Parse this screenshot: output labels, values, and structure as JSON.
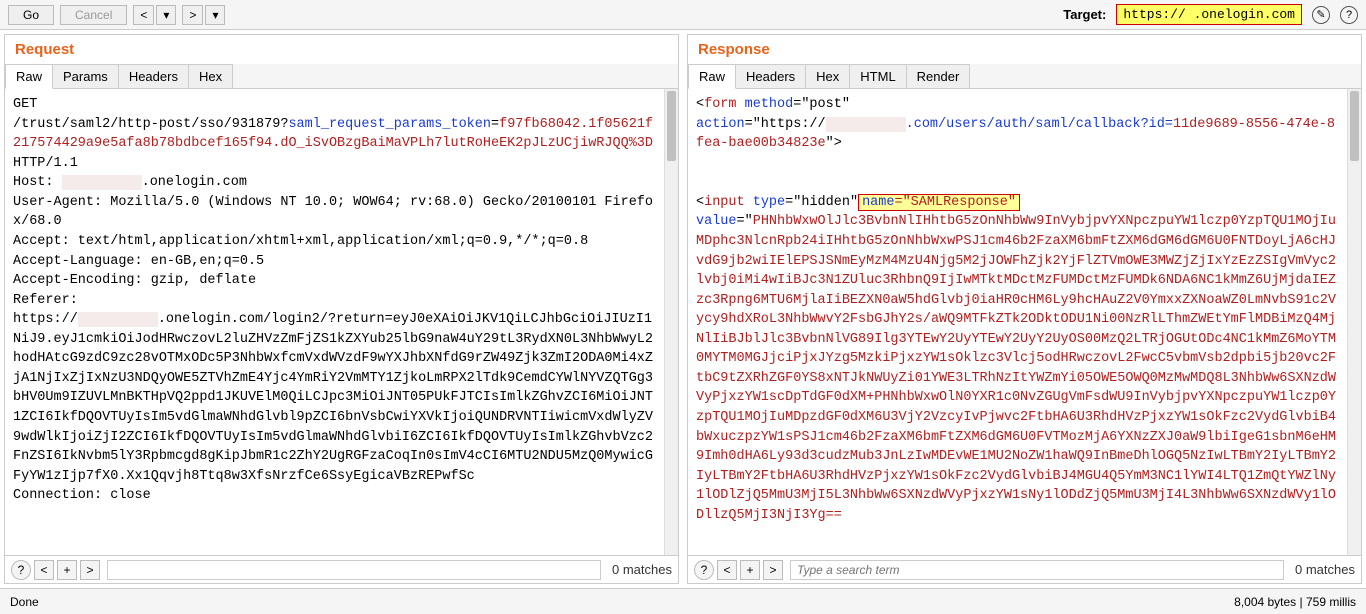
{
  "toolbar": {
    "go": "Go",
    "cancel": "Cancel",
    "prev_split": "<",
    "prev_down": "▾",
    "next_split": ">",
    "next_down": "▾",
    "target_label": "Target:",
    "target_value": "https://                  .onelogin.com"
  },
  "request": {
    "title": "Request",
    "tabs": [
      "Raw",
      "Params",
      "Headers",
      "Hex"
    ],
    "active_tab": 0,
    "method": "GET",
    "path1": "/trust/saml2/http-post/sso/931879?",
    "param_key": "saml_request_params_token",
    "param_val": "f97fb68042.1f05621f217574429a9e5afa8b78bdbcef165f94.dO_iSvOBzgBaiMaVPLh7lutRoHeEK2pJLzUCjiwRJQQ%3D",
    "httpver": " HTTP/1.1",
    "host_key": "Host: ",
    "host_val": ".onelogin.com",
    "ua": "User-Agent: Mozilla/5.0 (Windows NT 10.0; WOW64; rv:68.0) Gecko/20100101 Firefox/68.0",
    "accept": "Accept: text/html,application/xhtml+xml,application/xml;q=0.9,*/*;q=0.8",
    "acclang": "Accept-Language: en-GB,en;q=0.5",
    "accenc": "Accept-Encoding: gzip, deflate",
    "referer_key": "Referer:",
    "referer_scheme": "https://",
    "referer_rest": ".onelogin.com/login2/?return=eyJ0eXAiOiJKV1QiLCJhbGciOiJIUzI1NiJ9.eyJ1cmkiOiJodHRwczovL2luZHVzZmFjZS1kZXYub25lbG9naW4uY29tL3RydXN0L3NhbWwyL2hodHAtcG9zdC9zc28vOTMxODc5P3NhbWxfcmVxdWVzdF9wYXJhbXNfdG9rZW49Zjk3ZmI2ODA0Mi4xZjA1NjIxZjIxNzU3NDQyOWE5ZTVhZmE4Yjc4YmRiY2VmMTY1ZjkoLmRPX2lTdk9CemdCYWlNYVZQTGg3bHV0Um9IZUVLMnBKTHpVQ2ppd1JKUVElM0QiLCJpc3MiOiJNT05PUkFJTCIsImlkZGhvZCI6MiOiJNT1ZCI6IkfDQOVTUyIsIm5vdGlmaWNhdGlvbl9pZCI6bnVsbCwiYXVkIjoiQUNDRVNTIiwicmVxdWlyZV9wdWlkIjoiZjI2ZCI6IkfDQOVTUyIsIm5vdGlmaWNhdGlvbiI6ZCI6IkfDQOVTUyIsImlkZGhvbVzc2FnZSI6IkNvbm5lY3Rpbmcgd8gKipJbmR1c2ZhY2UgRGFzaCoqIn0sImV4cCI6MTU2NDU5MzQ0MywicGFyYW1zIjp7fX0.Xx1Qqvjh8Ttq8w3XfsNrzfCe6SsyEgicaVBzREPwfSc",
    "connection": "Connection: close",
    "search_placeholder": "",
    "matches": "0 matches"
  },
  "response": {
    "title": "Response",
    "tabs": [
      "Raw",
      "Headers",
      "Hex",
      "HTML",
      "Render"
    ],
    "active_tab": 0,
    "form_open1": "<",
    "form_tag": "form",
    "form_method_k": " method",
    "form_method_v": "=\"post\"",
    "form_action_k": "action",
    "form_action_pre": "=\"https://",
    "form_action_host_path": ".com/users/auth/saml/callback?id=",
    "form_action_id": "11de9689-8556-474e-8fea-bae00b34823e",
    "form_action_close": "\">",
    "input_open": "<",
    "input_tag": "input",
    "input_type_k": " type",
    "input_type_v": "=\"hidden\"",
    "input_name_k": "name",
    "input_name_v": "=\"SAMLResponse\"",
    "value_k": "value",
    "value_open": "=\"",
    "value_body": "PHNhbWxwOlJlc3BvbnNlIHhtbG5zOnNhbWw9InVybjpvYXNpczpuYW1lczp0YzpTQU1MOjIuMDphc3NlcnRpb24iIHhtbG5zOnNhbWxwPSJ1cm46b2FzaXM6bmFtZXM6dGM6dGM6U0FNTDoyLjA6cHJvdG9jb2wiIElEPSJSNmEyMzM4MzU4Njg5M2jJOWFhZjk2YjFlZTVmOWE3MWZjZjIxYzEzZSIgVmVyc2lvbj0iMi4wIiBJc3N1ZUluc3RhbnQ9IjIwMTktMDctMzFUMDctMzFUMDk6NDA6NC1kMmZ6UjMjdaIEZzc3Rpng6MTU6MjlaIiBEZXN0aW5hdGlvbj0iaHR0cHM6Ly9hcHAuZ2V0YmxxZXNoaWZ0LmNvbS91c2Vycy9hdXRoL3NhbWwvY2FsbGJhY2s/aWQ9MTFkZTk2ODktODU1Ni00NzRlLThmZWEtYmFlMDBiMzQ4MjNlIiBJblJlc3BvbnNlVG89Ilg3YTEwY2UyYTEwY2UyY2UyOS00MzQ2LTRjOGUtODc4NC1kMmZ6MoYTM0MYTM0MGJjciPjxJYzg5MzkiPjxzYW1sOklzc3Vlcj5odHRwczovL2FwcC5vbmVsb2dpbi5jb20vc2FtbC9tZXRhZGF0YS8xNTJkNWUyZi01YWE3LTRhNzItYWZmYi05OWE5OWQ0MzMwMDQ8L3NhbWw6SXNzdWVyPjxzYW1scDpTdGF0dXM+PHNhbWxwOlN0YXR1c0NvZGUgVmFsdWU9InVybjpvYXNpczpuYW1lczp0YzpTQU1MOjIuMDpzdGF0dXM6U3VjY2VzcyIvPjwvc2FtbHA6U3RhdHVzPjxzYW1sOkFzc2VydGlvbiB4bWxuczpzYW1sPSJ1cm46b2FzaXM6bmFtZXM6dGM6U0FVTMozMjA6YXNzZXJ0aW9lbiIgeG1sbnM6eHM9Imh0dHA6Ly93d3cudzMub3JnLzIwMDEvWE1MU2NoZW1haWQ9InBmeDhlOGQ5NzIwLTBmY2IyLTBmY2IyLTBmY2FtbHA6U3RhdHVzPjxzYW1sOkFzc2VydGlvbiBJ4MGU4Q5YmM3NC1lYWI4LTQ1ZmQtYWZlNy1lODlZjQ5MmU3MjI5L3NhbWw6SXNzdWVyPjxzYW1sNy1lODdZjQ5MmU3MjI4L3NhbWw6SXNzdWVy1lODllzQ5MjI3NjI3Yg==",
    "search_placeholder": "Type a search term",
    "matches": "0 matches"
  },
  "status": {
    "left": "Done",
    "right": "8,004 bytes | 759 millis"
  },
  "footer_icons": {
    "help": "?",
    "back": "<",
    "plus": "+",
    "fwd": ">"
  }
}
